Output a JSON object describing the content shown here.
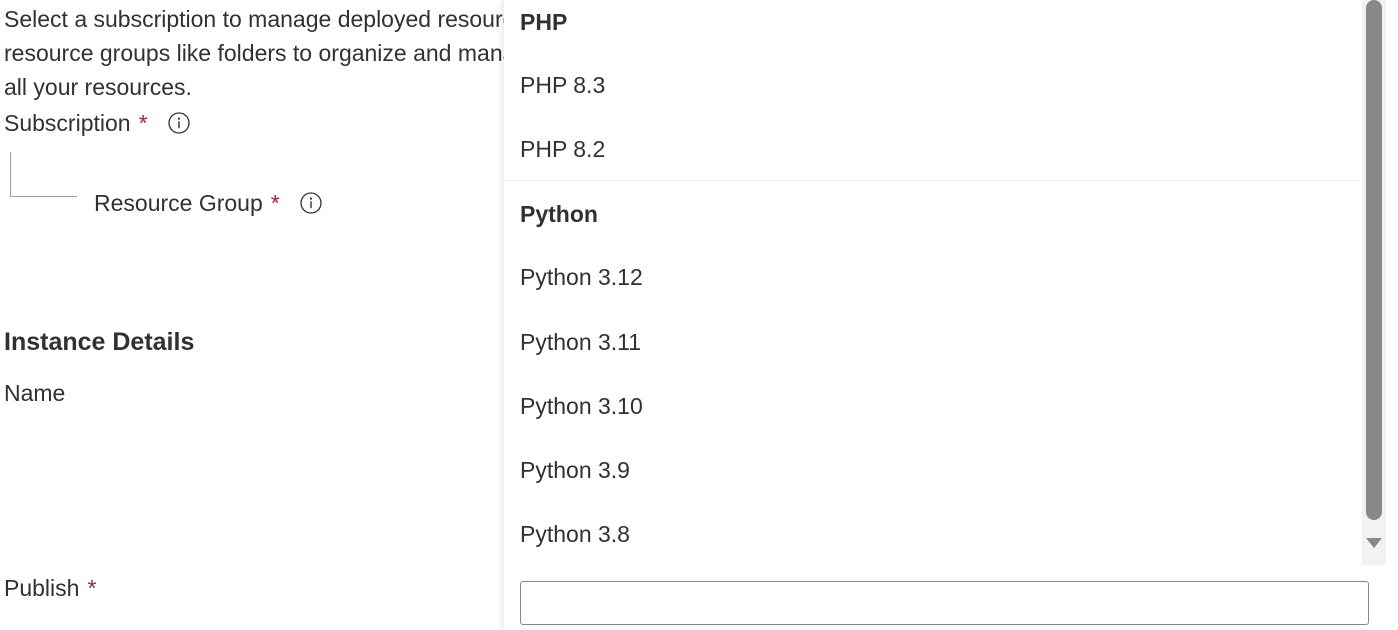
{
  "form": {
    "description_line1": "Select a subscription to manage deployed resources and costs. Use resource groups like folders to organize and manage",
    "description_line2": "all your resources.",
    "subscription_label": "Subscription",
    "resource_group_label": "Resource Group",
    "required_marker": "*",
    "instance_details_title": "Instance Details",
    "name_label": "Name",
    "publish_label": "Publish"
  },
  "dropdown": {
    "groups": [
      {
        "header": "PHP",
        "options": [
          "PHP 8.3",
          "PHP 8.2"
        ]
      },
      {
        "header": "Python",
        "options": [
          "Python 3.12",
          "Python 3.11",
          "Python 3.10",
          "Python 3.9",
          "Python 3.8"
        ]
      }
    ],
    "input_value": ""
  },
  "icons": {
    "info": "info-circle-icon",
    "scroll_down": "triangle-down-icon"
  },
  "colors": {
    "required": "#a4262c",
    "text": "#323130",
    "scroll_thumb": "#8a8886"
  }
}
